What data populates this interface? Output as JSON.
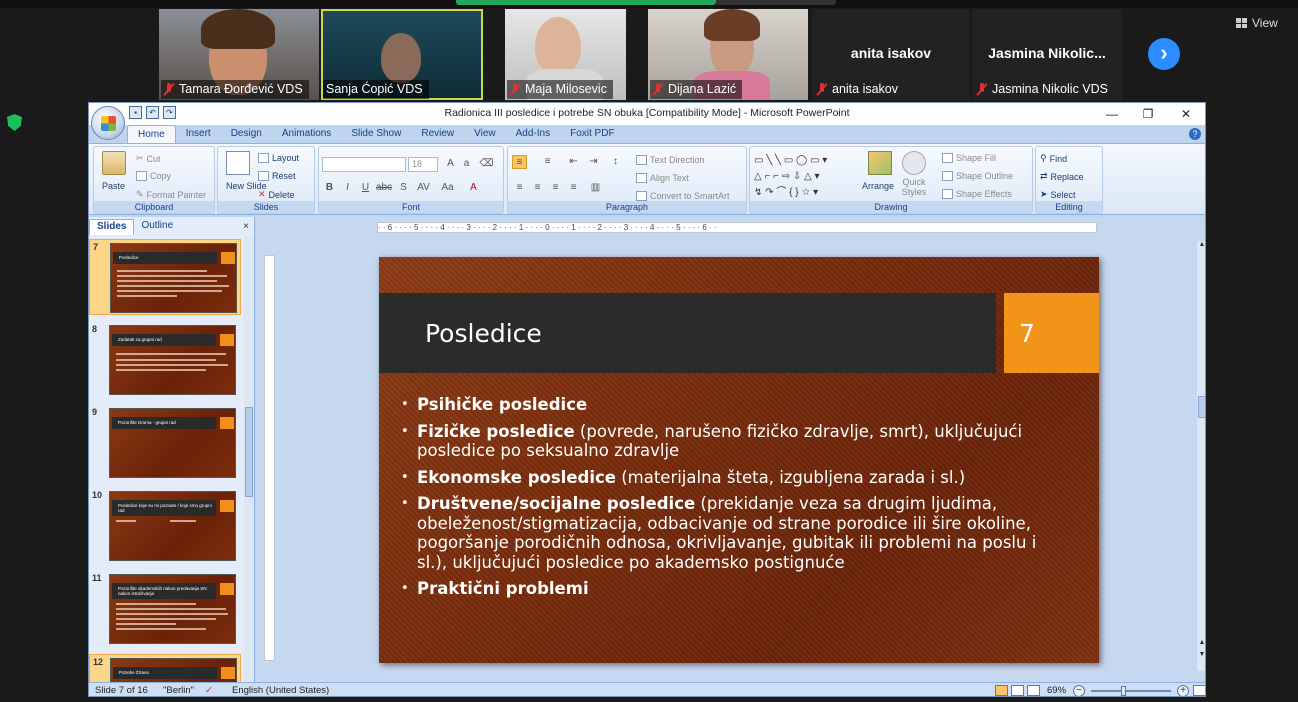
{
  "meeting": {
    "view_label": "View",
    "participants": [
      {
        "name": "Tamara Đorđević VDS",
        "muted": true,
        "video": true
      },
      {
        "name": "Sanja Ćopić VDS",
        "muted": false,
        "video": true,
        "active": true
      },
      {
        "name": "Maja Milosevic",
        "muted": true,
        "video": true
      },
      {
        "name": "Dijana Lazić",
        "muted": true,
        "video": true
      },
      {
        "name": "anita isakov",
        "muted": true,
        "video": false,
        "display_name": "anita isakov"
      },
      {
        "name": "Jasmina Nikolic VDS",
        "muted": true,
        "video": false,
        "display_name": "Jasmina  Nikolic..."
      }
    ],
    "next_arrow": "›"
  },
  "powerpoint": {
    "window_title": "Radionica III posledice i potrebe SN obuka [Compatibility Mode] - Microsoft PowerPoint",
    "window_controls": {
      "minimize": "—",
      "restore": "❐",
      "close": "✕"
    },
    "tabs": [
      "Home",
      "Insert",
      "Design",
      "Animations",
      "Slide Show",
      "Review",
      "View",
      "Add-Ins",
      "Foxit PDF"
    ],
    "active_tab": "Home",
    "ribbon": {
      "clipboard": {
        "label": "Clipboard",
        "paste": "Paste",
        "cut": "Cut",
        "copy": "Copy",
        "format_painter": "Format Painter"
      },
      "slides": {
        "label": "Slides",
        "new_slide": "New Slide",
        "new_slide_arrow": "▾",
        "layout": "Layout",
        "reset": "Reset",
        "delete": "Delete"
      },
      "font": {
        "label": "Font",
        "font_size": "18"
      },
      "paragraph": {
        "label": "Paragraph",
        "text_direction": "Text Direction",
        "align_text": "Align Text",
        "convert_smartart": "Convert to SmartArt"
      },
      "drawing": {
        "label": "Drawing",
        "arrange": "Arrange",
        "quick_styles": "Quick Styles",
        "shape_fill": "Shape Fill",
        "shape_outline": "Shape Outline",
        "shape_effects": "Shape Effects"
      },
      "editing": {
        "label": "Editing",
        "find": "Find",
        "replace": "Replace",
        "select": "Select"
      }
    },
    "pane": {
      "tab_slides": "Slides",
      "tab_outline": "Outline",
      "close": "×",
      "thumbnails": [
        {
          "num": "7",
          "title": "Posledice",
          "selected": true
        },
        {
          "num": "8",
          "title": "Zadatak za grupni  rad"
        },
        {
          "num": "9",
          "title": "Pozorište Drama - grupni rad"
        },
        {
          "num": "10",
          "title": "Posledice koje su mi poznate / koje smo grupni rad"
        },
        {
          "num": "11",
          "title": "Pozorište akademskih nakon predavanja SN: nakon istraživanja"
        },
        {
          "num": "12",
          "title": "Potrebe Žrtava"
        }
      ]
    },
    "ruler_text": "· · 6 · · · · 5 · · · · 4 · · · · 3 · · · · 2 · · · · 1 · · · · 0 · · · · 1 · · · · 2 · · · · 3 · · · · 4 · · · · 5 · · · · 6 · ·",
    "slide": {
      "title": "Posledice",
      "number": "7",
      "bullets": [
        {
          "bold": "Psihičke posledice",
          "rest": ""
        },
        {
          "bold": "Fizičke posledice",
          "rest": " (povrede, narušeno fizičko zdravlje, smrt), uključujući posledice po seksualno zdravlje"
        },
        {
          "bold": "Ekonomske posledice",
          "rest": " (materijalna šteta, izgubljena zarada i sl.)"
        },
        {
          "bold": "Društvene/socijalne posledice",
          "rest": " (prekidanje veza sa drugim ljudima, obeleženost/stigmatizacija, odbacivanje od strane porodice ili šire okoline, pogoršanje porodičnih odnosa, okrivljavanje, gubitak ili problemi na poslu i sl.), uključujući posledice po akademsko postignuće"
        },
        {
          "bold": "Praktični problemi",
          "rest": ""
        }
      ]
    },
    "status": {
      "slide_pos": "Slide 7 of 16",
      "theme": "\"Berlin\"",
      "language": "English (United States)",
      "zoom": "69%"
    }
  }
}
